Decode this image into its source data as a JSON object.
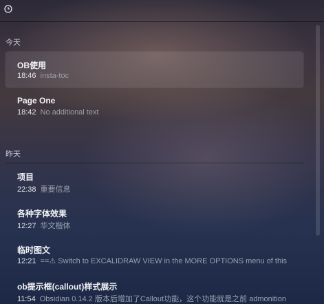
{
  "sections": [
    {
      "label": "今天",
      "items": [
        {
          "title": "OB使用",
          "time": "18:46",
          "preview": "insta-toc"
        },
        {
          "title": "Page One",
          "time": "18:42",
          "preview": "No additional text"
        }
      ]
    },
    {
      "label": "昨天",
      "items": [
        {
          "title": "项目",
          "time": "22:38",
          "preview": "重要信息"
        },
        {
          "title": "各种字体效果",
          "time": "12:27",
          "preview": "华文楷体"
        },
        {
          "title": "临时图文",
          "time": "12:21",
          "preview": "==⚠ Switch to EXCALIDRAW VIEW in the MORE OPTIONS menu of this"
        },
        {
          "title": "ob提示框(callout)样式展示",
          "time": "11:54",
          "preview": "Obsidian 0.14.2 版本后增加了Callout功能，这个功能就是之前 admonition"
        }
      ]
    }
  ],
  "icons": {
    "history": "clock-icon"
  }
}
